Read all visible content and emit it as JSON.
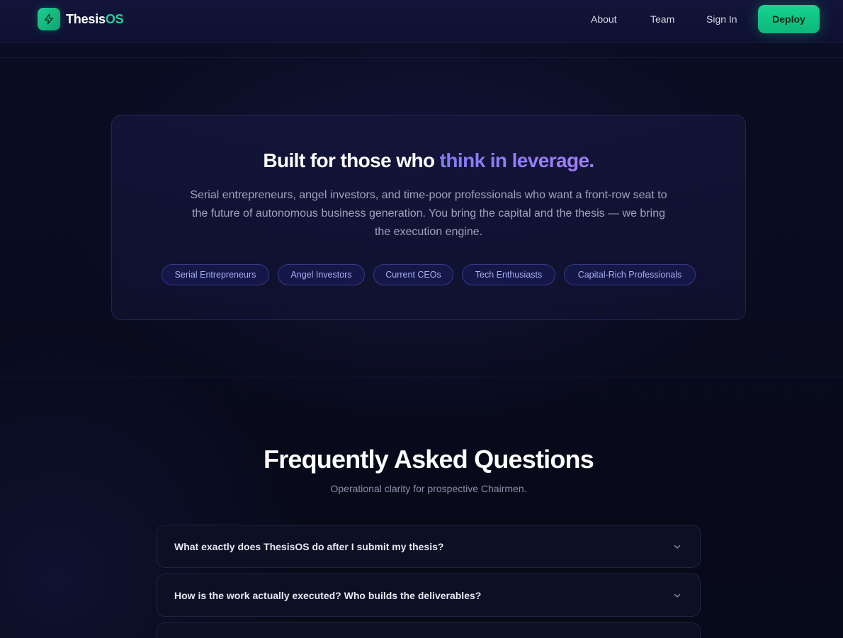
{
  "header": {
    "brand_main": "Thesis",
    "brand_accent": "OS",
    "nav": [
      "About",
      "Team",
      "Sign In"
    ],
    "cta": "Deploy",
    "logo_icon": "lightning-bolt-icon"
  },
  "audience": {
    "title_plain": "Built for those who ",
    "title_highlight": "think in leverage.",
    "description": "Serial entrepreneurs, angel investors, and time-poor professionals who want a front-row seat to the future of autonomous business generation. You bring the capital and the thesis — we bring the execution engine.",
    "tags": [
      "Serial Entrepreneurs",
      "Angel Investors",
      "Current CEOs",
      "Tech Enthusiasts",
      "Capital-Rich Professionals"
    ]
  },
  "faq": {
    "title": "Frequently Asked Questions",
    "subtitle": "Operational clarity for prospective Chairmen.",
    "items": [
      {
        "question": "What exactly does ThesisOS do after I submit my thesis?"
      },
      {
        "question": "How is the work actually executed? Who builds the deliverables?"
      },
      {
        "question": ""
      }
    ],
    "expand_icon": "chevron-down-icon"
  },
  "colors": {
    "brand_green": "#15d58f",
    "accent_purple": "#8f7df6",
    "background": "#080b1c"
  }
}
